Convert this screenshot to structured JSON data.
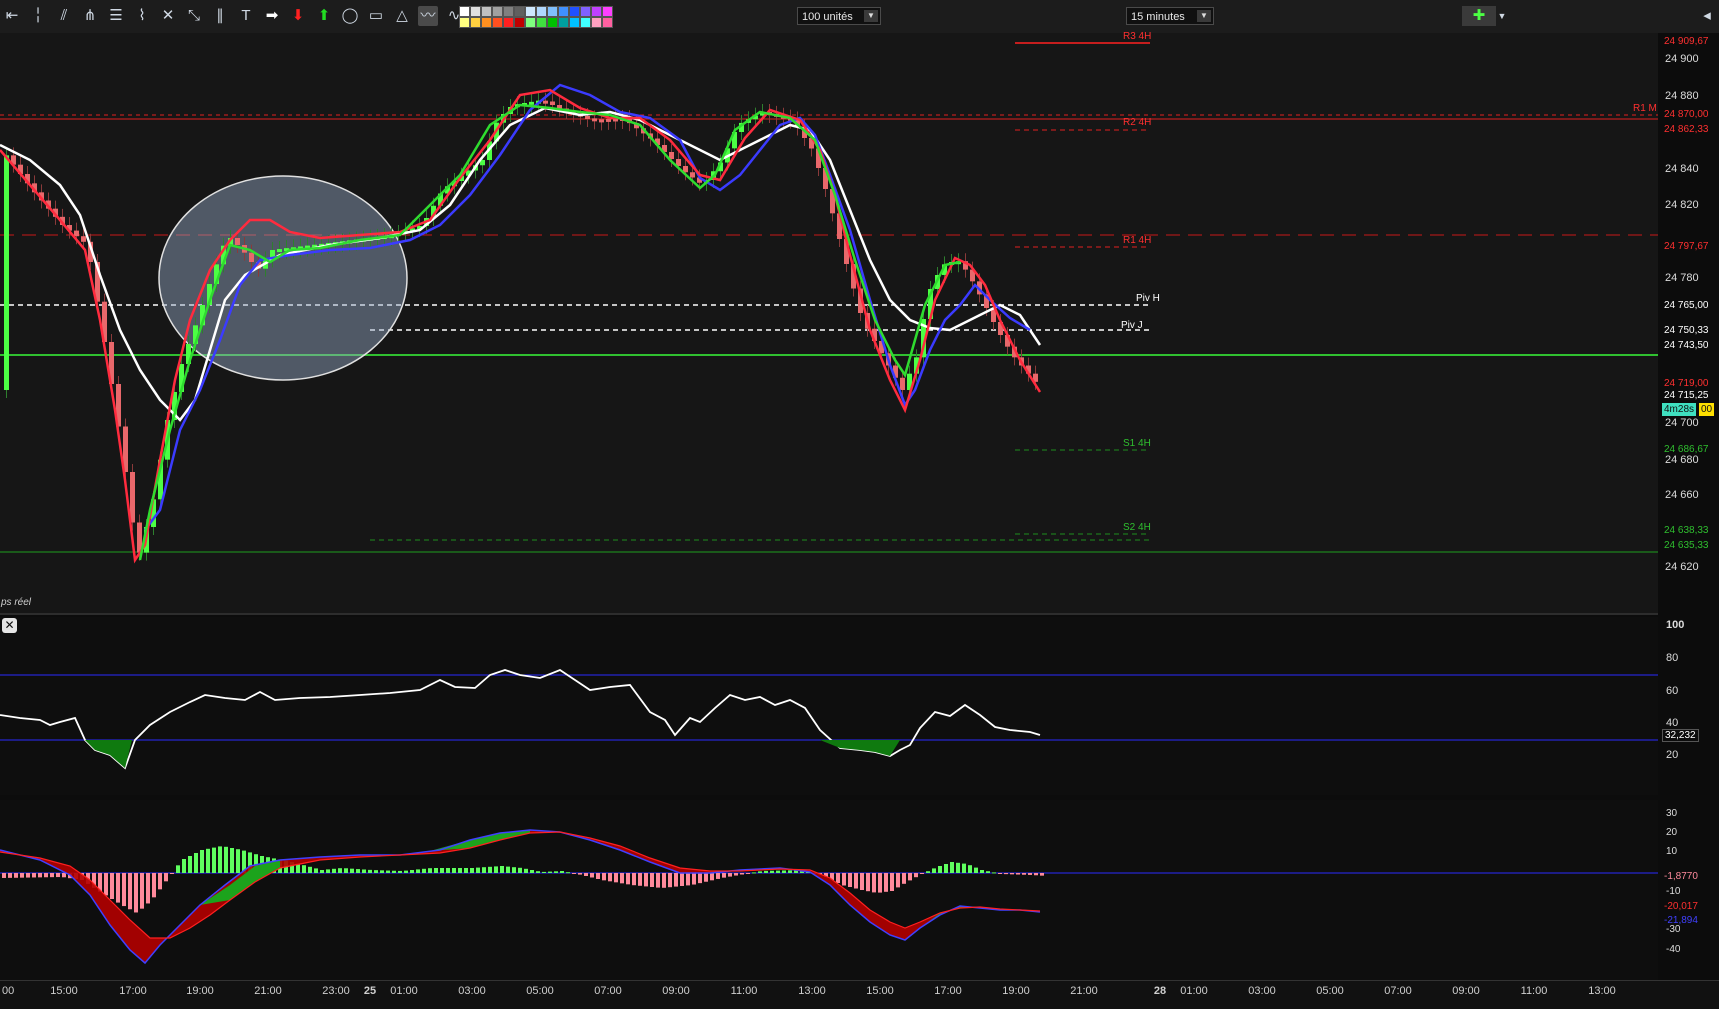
{
  "toolbar": {
    "tools": [
      "back-arrow",
      "cursor",
      "fan-lines",
      "pitchfork",
      "fibonacci-retracement",
      "zigzag",
      "wrench",
      "resize-arrows",
      "parallel-lines",
      "text-tool",
      "right-arrow",
      "down-arrow",
      "up-arrow",
      "ellipse-tool",
      "rectangle-tool",
      "triangle-tool",
      "indicator-active",
      "wave-tool"
    ],
    "units_select": "100 unités",
    "timeframe_select": "15 minutes"
  },
  "colors": {
    "bull": "#4cff44",
    "bear": "#e9686b",
    "white_ma": "#ffffff",
    "red_ma": "#ff2b3e",
    "blue_ma": "#3b3bff",
    "green_ma": "#2fdc2f",
    "rsi_band": "#2a2aff",
    "support_green": "#22c022"
  },
  "price_panel": {
    "realtime_label": "ps réel",
    "line_labels": {
      "r3": "R3 4H",
      "r2": "R2 4H",
      "r1": "R1 4H",
      "r1m": "R1 M",
      "piv_h": "Piv H",
      "piv_j": "Piv J",
      "s1": "S1 4H",
      "s2": "S2 4H"
    },
    "axis_labels": [
      "24 900",
      "24 880",
      "24 840",
      "24 820",
      "24 780",
      "24 700",
      "24 680",
      "24 660",
      "24 620"
    ],
    "price_boxes": {
      "r3": "24 909,67",
      "r1m": "24 870,00",
      "r2": "24 862,33",
      "r1": "24 797,67",
      "pivh": "24 765,00",
      "pivj": "24 750,33",
      "last_white": "24 743,50",
      "red_ma": "24 719,00",
      "price": "24 715,25",
      "countdown": "4m28s",
      "countdown_tail": "00",
      "s1": "24 686,67",
      "s2": "24 638,33",
      "support": "24 635,33"
    }
  },
  "rsi_panel": {
    "axis_labels": [
      "100",
      "80",
      "60",
      "40",
      "20"
    ],
    "value_box": "32,232"
  },
  "macd_panel": {
    "axis_labels": [
      "30",
      "20",
      "10",
      "-10",
      "-30",
      "-40"
    ],
    "value_boxes": {
      "histogram": "-1,8770",
      "signal": "-20,017",
      "macd": "-21,894"
    }
  },
  "time_axis": [
    "00",
    "15:00",
    "17:00",
    "19:00",
    "21:00",
    "23:00",
    "25",
    "01:00",
    "03:00",
    "05:00",
    "07:00",
    "09:00",
    "11:00",
    "13:00",
    "15:00",
    "17:00",
    "19:00",
    "21:00",
    "28",
    "01:00",
    "03:00",
    "05:00",
    "07:00",
    "09:00",
    "11:00",
    "13:00"
  ]
}
